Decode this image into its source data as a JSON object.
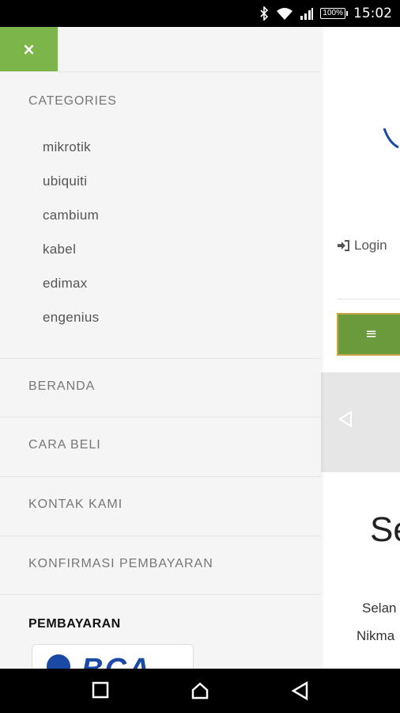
{
  "status_bar": {
    "battery": "100%",
    "time": "15:02",
    "icons": [
      "bluetooth-icon",
      "wifi-icon",
      "signal-icon",
      "battery-icon"
    ]
  },
  "drawer": {
    "close_label": "×",
    "categories_heading": "CATEGORIES",
    "categories": [
      "mikrotik",
      "ubiquiti",
      "cambium",
      "kabel",
      "edimax",
      "engenius"
    ],
    "nav": [
      "BERANDA",
      "CARA BELI",
      "KONTAK KAMI",
      "KONFIRMASI PEMBAYARAN"
    ],
    "payment_heading": "PEMBAYARAN",
    "bank": "BCA"
  },
  "page": {
    "login_label": "Login",
    "title_partial": "Se",
    "line1_partial": "Selan",
    "line2_partial": "Nikma"
  },
  "colors": {
    "accent_green": "#7cb54a",
    "menu_green": "#6a9a3b",
    "brand_blue": "#1b4aa6"
  }
}
